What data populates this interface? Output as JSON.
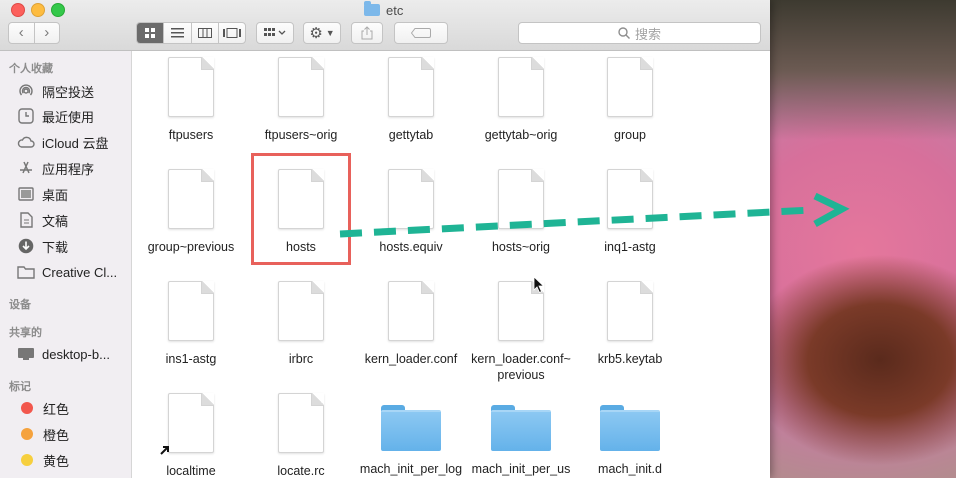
{
  "window": {
    "title": "etc"
  },
  "toolbar": {
    "search_placeholder": "搜索"
  },
  "sidebar": {
    "favorites_header": "个人收藏",
    "favorites": [
      {
        "label": "隔空投送",
        "icon": "airdrop-icon"
      },
      {
        "label": "最近使用",
        "icon": "clock-icon"
      },
      {
        "label": "iCloud 云盘",
        "icon": "cloud-icon"
      },
      {
        "label": "应用程序",
        "icon": "apps-icon"
      },
      {
        "label": "桌面",
        "icon": "desktop-icon"
      },
      {
        "label": "文稿",
        "icon": "document-icon"
      },
      {
        "label": "下载",
        "icon": "download-icon"
      },
      {
        "label": "Creative Cl...",
        "icon": "folder-icon"
      }
    ],
    "devices_header": "设备",
    "shared_header": "共享的",
    "shared": [
      {
        "label": "desktop-b...",
        "icon": "display-icon"
      }
    ],
    "tags_header": "标记",
    "tags": [
      {
        "label": "红色",
        "color": "#f2574d"
      },
      {
        "label": "橙色",
        "color": "#f5a23d"
      },
      {
        "label": "黄色",
        "color": "#f6cf3e"
      }
    ]
  },
  "files": [
    {
      "name": "ftpusers",
      "type": "doc"
    },
    {
      "name": "ftpusers~orig",
      "type": "doc"
    },
    {
      "name": "gettytab",
      "type": "doc"
    },
    {
      "name": "gettytab~orig",
      "type": "doc"
    },
    {
      "name": "group",
      "type": "doc"
    },
    {
      "name": "group~previous",
      "type": "doc"
    },
    {
      "name": "hosts",
      "type": "doc"
    },
    {
      "name": "hosts.equiv",
      "type": "doc"
    },
    {
      "name": "hosts~orig",
      "type": "doc"
    },
    {
      "name": "inq1-astg",
      "type": "doc"
    },
    {
      "name": "ins1-astg",
      "type": "doc"
    },
    {
      "name": "irbrc",
      "type": "doc"
    },
    {
      "name": "kern_loader.conf",
      "type": "doc"
    },
    {
      "name": "kern_loader.conf~\nprevious",
      "type": "doc"
    },
    {
      "name": "krb5.keytab",
      "type": "doc"
    },
    {
      "name": "localtime",
      "type": "doc"
    },
    {
      "name": "locate.rc",
      "type": "doc"
    },
    {
      "name": "mach_init_per_log",
      "type": "folder"
    },
    {
      "name": "mach_init_per_us",
      "type": "folder"
    },
    {
      "name": "mach_init.d",
      "type": "folder"
    }
  ],
  "colors": {
    "highlight": "#e8615b",
    "arrow": "#1fb495"
  }
}
